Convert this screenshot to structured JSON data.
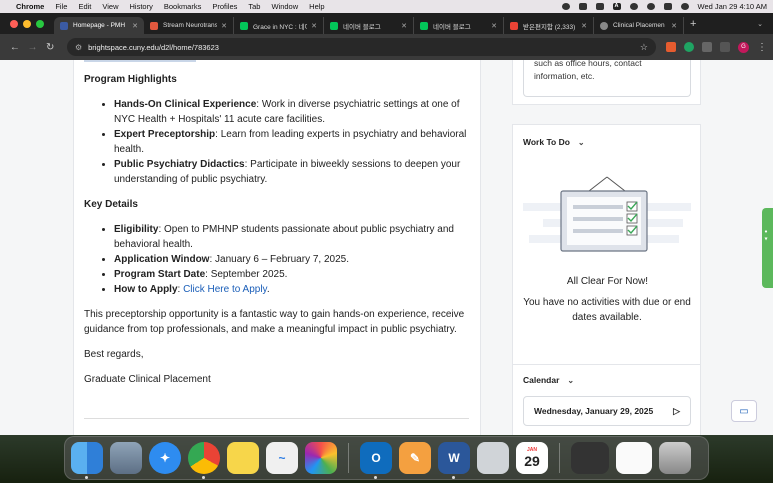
{
  "menubar": {
    "app": "Chrome",
    "items": [
      "File",
      "Edit",
      "View",
      "History",
      "Bookmarks",
      "Profiles",
      "Tab",
      "Window",
      "Help"
    ],
    "clock": "Wed Jan 29  4:10 AM"
  },
  "tabs": [
    {
      "title": "Homepage - PMH",
      "color": "#3b5ba5",
      "active": true
    },
    {
      "title": "Stream Neurotrans",
      "color": "#e2583e",
      "active": false
    },
    {
      "title": "Grace in NYC : 네이",
      "color": "#03c75a",
      "active": false
    },
    {
      "title": "네이버 블로그",
      "color": "#03c75a",
      "active": false
    },
    {
      "title": "네이버 블로그",
      "color": "#03c75a",
      "active": false
    },
    {
      "title": "받은편지함 (2,333)",
      "color": "#ea4335",
      "active": false
    },
    {
      "title": "Clinical Placemen",
      "color": "#888888",
      "active": false
    }
  ],
  "address": {
    "url": "brightspace.cuny.edu/d2l/home/783623"
  },
  "profile_initial": "G",
  "content": {
    "highlights_heading": "Program Highlights",
    "highlights": [
      {
        "bold": "Hands-On Clinical Experience",
        "text": ": Work in diverse psychiatric settings at one of NYC Health + Hospitals' 11 acute care facilities."
      },
      {
        "bold": "Expert Preceptorship",
        "text": ": Learn from leading experts in psychiatry and behavioral health."
      },
      {
        "bold": "Public Psychiatry Didactics",
        "text": ": Participate in biweekly sessions to deepen your understanding of public psychiatry."
      }
    ],
    "details_heading": "Key Details",
    "details": [
      {
        "bold": "Eligibility",
        "text": ": Open to PMHNP students passionate about public psychiatry and behavioral health."
      },
      {
        "bold": "Application Window",
        "text": ": January 6 – February 7, 2025."
      },
      {
        "bold": "Program Start Date",
        "text": ": September 2025."
      }
    ],
    "apply_bold": "How to Apply",
    "apply_sep": ": ",
    "apply_link": "Click Here to Apply",
    "apply_end": ".",
    "para": "This preceptorship opportunity is a fantastic way to gain hands-on experience, receive guidance from top professionals, and make a meaningful impact in public psychiatry.",
    "regards": "Best regards,",
    "signature": "Graduate Clinical Placement"
  },
  "office_hours_text": "such as office hours, contact information, etc.",
  "work_to_do": {
    "title": "Work To Do",
    "clear_title": "All Clear For Now!",
    "clear_text": "You have no activities with due or end dates available."
  },
  "calendar": {
    "title": "Calendar",
    "date": "Wednesday, January 29, 2025"
  },
  "dock": {
    "calendar_month": "JAN",
    "calendar_day": "29"
  }
}
